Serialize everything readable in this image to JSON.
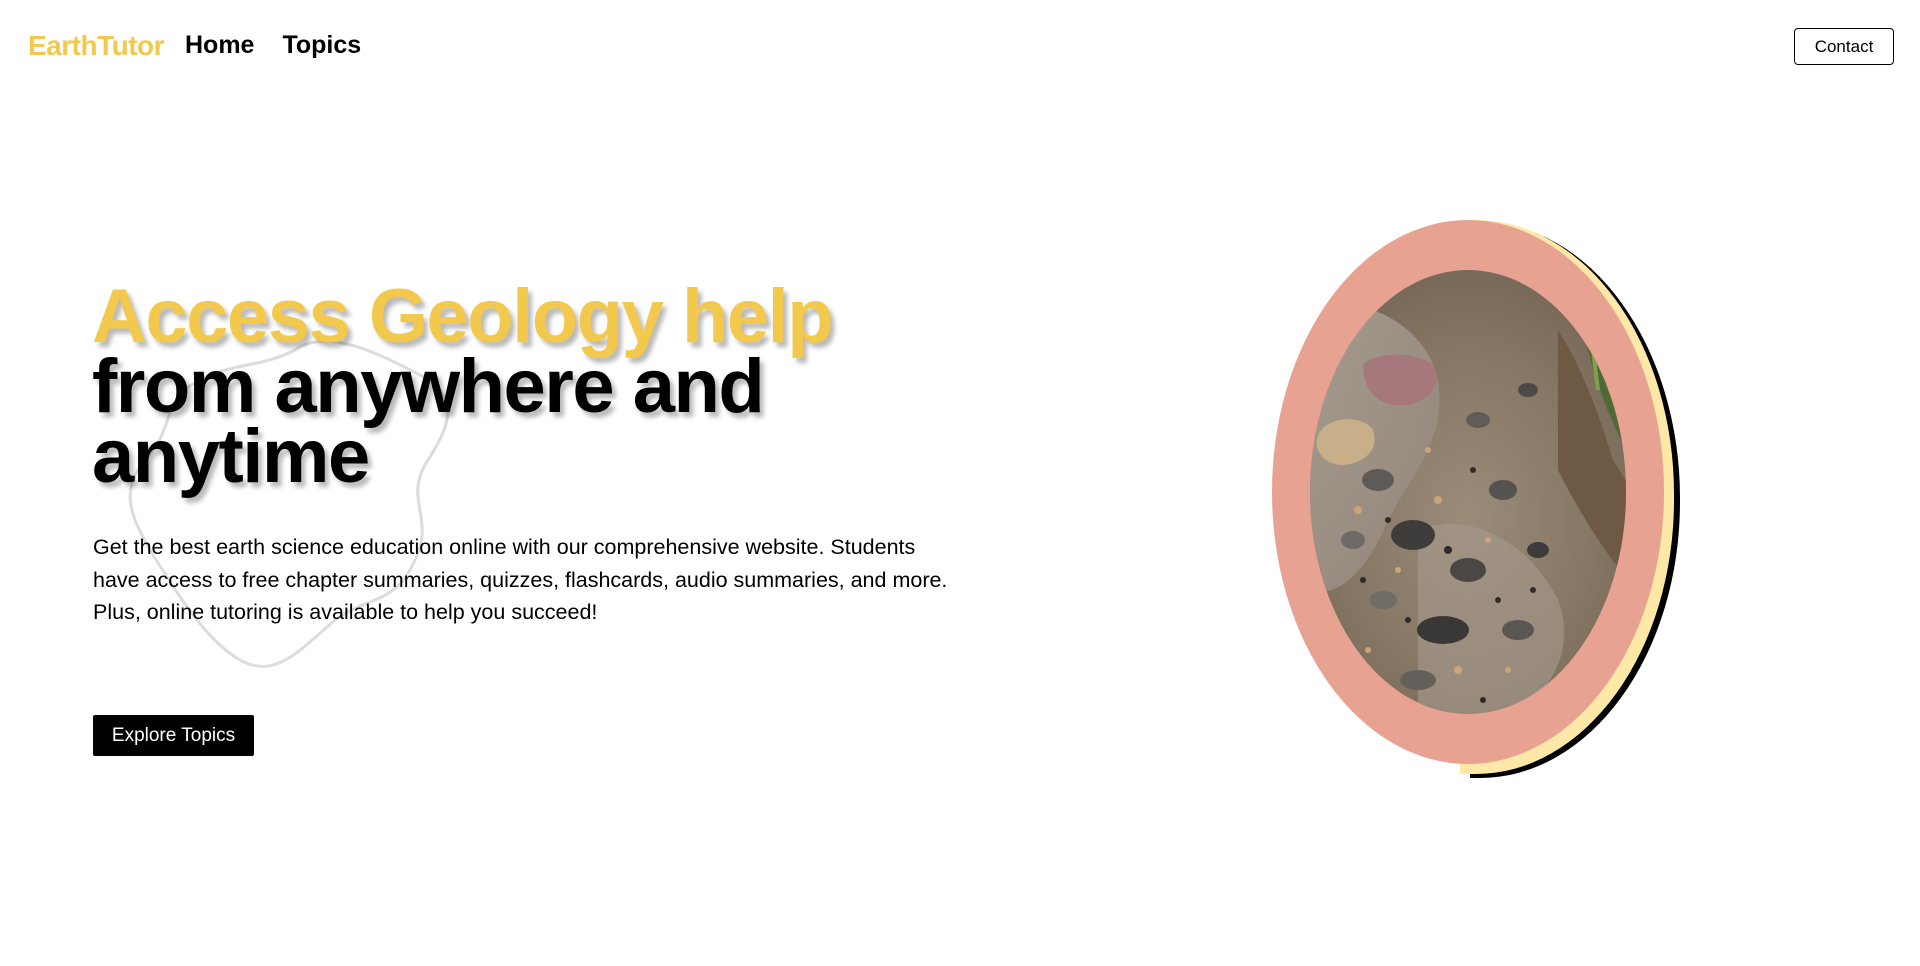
{
  "header": {
    "logo": "EarthTutor",
    "nav": [
      {
        "label": "Home"
      },
      {
        "label": "Topics"
      }
    ],
    "contact_label": "Contact"
  },
  "hero": {
    "headline_accent": "Access Geology help",
    "headline_rest": "from anywhere and anytime",
    "description": "Get the best earth science education online with our comprehensive website. Students have access to free chapter summaries, quizzes, flashcards, audio summaries, and more. Plus, online tutoring is available to help you succeed!",
    "cta_label": "Explore Topics"
  },
  "colors": {
    "brand_yellow": "#f2c94c",
    "frame_salmon": "#e8a291",
    "frame_cream": "#fde8a7",
    "button_black": "#000000"
  },
  "illustration": {
    "subject": "rocky-stream-bed-photo"
  }
}
